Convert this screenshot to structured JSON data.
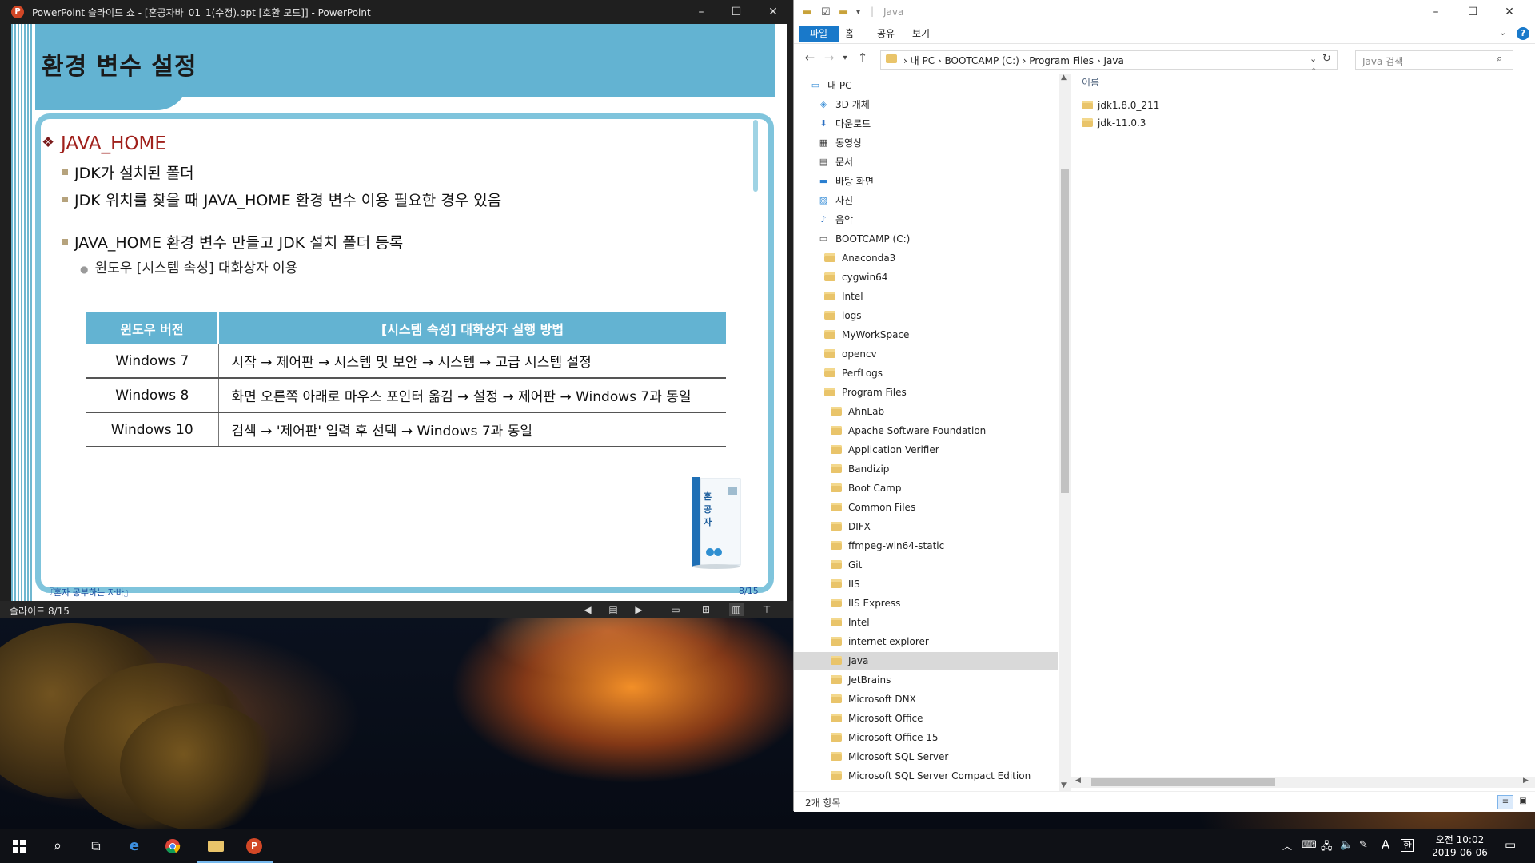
{
  "powerpoint": {
    "title": "PowerPoint 슬라이드 쇼 - [혼공자바_01_1(수정).ppt [호환 모드]] - PowerPoint",
    "slide": {
      "title": "환경 변수 설정",
      "heading": "JAVA_HOME",
      "bullets": [
        "JDK가 설치된 폴더",
        "JDK 위치를 찾을 때 JAVA_HOME 환경 변수 이용 필요한 경우 있음",
        "JAVA_HOME 환경 변수 만들고 JDK 설치 폴더 등록"
      ],
      "sub_bullet": "윈도우 [시스템 속성] 대화상자 이용",
      "table": {
        "headers": [
          "윈도우 버전",
          "[시스템 속성] 대화상자 실행 방법"
        ],
        "rows": [
          [
            "Windows 7",
            "시작 → 제어판 → 시스템 및 보안 → 시스템 → 고급 시스템 설정"
          ],
          [
            "Windows 8",
            "화면 오른쪽 아래로 마우스 포인터 옮김 → 설정 → 제어판 → Windows 7과 동일"
          ],
          [
            "Windows 10",
            "검색 → '제어판' 입력 후 선택 → Windows 7과 동일"
          ]
        ]
      },
      "footer_left": "『혼자 공부하는 자바』",
      "footer_right": "8/15",
      "book_text": "혼자 공부하는 자바"
    },
    "status": "슬라이드 8/15"
  },
  "explorer": {
    "title": "Java",
    "tabs": [
      "파일",
      "홈",
      "공유",
      "보기"
    ],
    "breadcrumb": "›  내 PC  ›  BOOTCAMP (C:)  ›  Program Files  ›  Java",
    "search_placeholder": "Java 검색",
    "tree": [
      {
        "label": "내 PC",
        "icon": "pc-icon",
        "level": 0
      },
      {
        "label": "3D 개체",
        "icon": "cube-icon",
        "level": 1
      },
      {
        "label": "다운로드",
        "icon": "download-icon",
        "level": 1
      },
      {
        "label": "동영상",
        "icon": "video-icon",
        "level": 1
      },
      {
        "label": "문서",
        "icon": "document-icon",
        "level": 1
      },
      {
        "label": "바탕 화면",
        "icon": "desktop-icon",
        "level": 1
      },
      {
        "label": "사진",
        "icon": "picture-icon",
        "level": 1
      },
      {
        "label": "음악",
        "icon": "music-icon",
        "level": 1
      },
      {
        "label": "BOOTCAMP (C:)",
        "icon": "drive-icon",
        "level": 1
      },
      {
        "label": "Anaconda3",
        "icon": "folder-icon",
        "level": 2
      },
      {
        "label": "cygwin64",
        "icon": "folder-icon",
        "level": 2
      },
      {
        "label": "Intel",
        "icon": "folder-icon",
        "level": 2
      },
      {
        "label": "logs",
        "icon": "folder-icon",
        "level": 2
      },
      {
        "label": "MyWorkSpace",
        "icon": "folder-icon",
        "level": 2
      },
      {
        "label": "opencv",
        "icon": "folder-icon",
        "level": 2
      },
      {
        "label": "PerfLogs",
        "icon": "folder-icon",
        "level": 2
      },
      {
        "label": "Program Files",
        "icon": "folder-icon",
        "level": 2
      },
      {
        "label": "AhnLab",
        "icon": "folder-icon",
        "level": 3
      },
      {
        "label": "Apache Software Foundation",
        "icon": "folder-icon",
        "level": 3
      },
      {
        "label": "Application Verifier",
        "icon": "folder-icon",
        "level": 3
      },
      {
        "label": "Bandizip",
        "icon": "folder-icon",
        "level": 3
      },
      {
        "label": "Boot Camp",
        "icon": "folder-icon",
        "level": 3
      },
      {
        "label": "Common Files",
        "icon": "folder-icon",
        "level": 3
      },
      {
        "label": "DIFX",
        "icon": "folder-icon",
        "level": 3
      },
      {
        "label": "ffmpeg-win64-static",
        "icon": "folder-icon",
        "level": 3
      },
      {
        "label": "Git",
        "icon": "folder-icon",
        "level": 3
      },
      {
        "label": "IIS",
        "icon": "folder-icon",
        "level": 3
      },
      {
        "label": "IIS Express",
        "icon": "folder-icon",
        "level": 3
      },
      {
        "label": "Intel",
        "icon": "folder-icon",
        "level": 3
      },
      {
        "label": "internet explorer",
        "icon": "folder-icon",
        "level": 3
      },
      {
        "label": "Java",
        "icon": "folder-icon",
        "level": 3,
        "selected": true
      },
      {
        "label": "JetBrains",
        "icon": "folder-icon",
        "level": 3
      },
      {
        "label": "Microsoft DNX",
        "icon": "folder-icon",
        "level": 3
      },
      {
        "label": "Microsoft Office",
        "icon": "folder-icon",
        "level": 3
      },
      {
        "label": "Microsoft Office 15",
        "icon": "folder-icon",
        "level": 3
      },
      {
        "label": "Microsoft SQL Server",
        "icon": "folder-icon",
        "level": 3
      },
      {
        "label": "Microsoft SQL Server Compact Edition",
        "icon": "folder-icon",
        "level": 3
      }
    ],
    "column_name": "이름",
    "files": [
      "jdk1.8.0_211",
      "jdk-11.0.3"
    ],
    "status": "2개 항목"
  },
  "taskbar": {
    "ime": "A",
    "ime2": "한",
    "time": "오전 10:02",
    "date": "2019-06-06"
  }
}
